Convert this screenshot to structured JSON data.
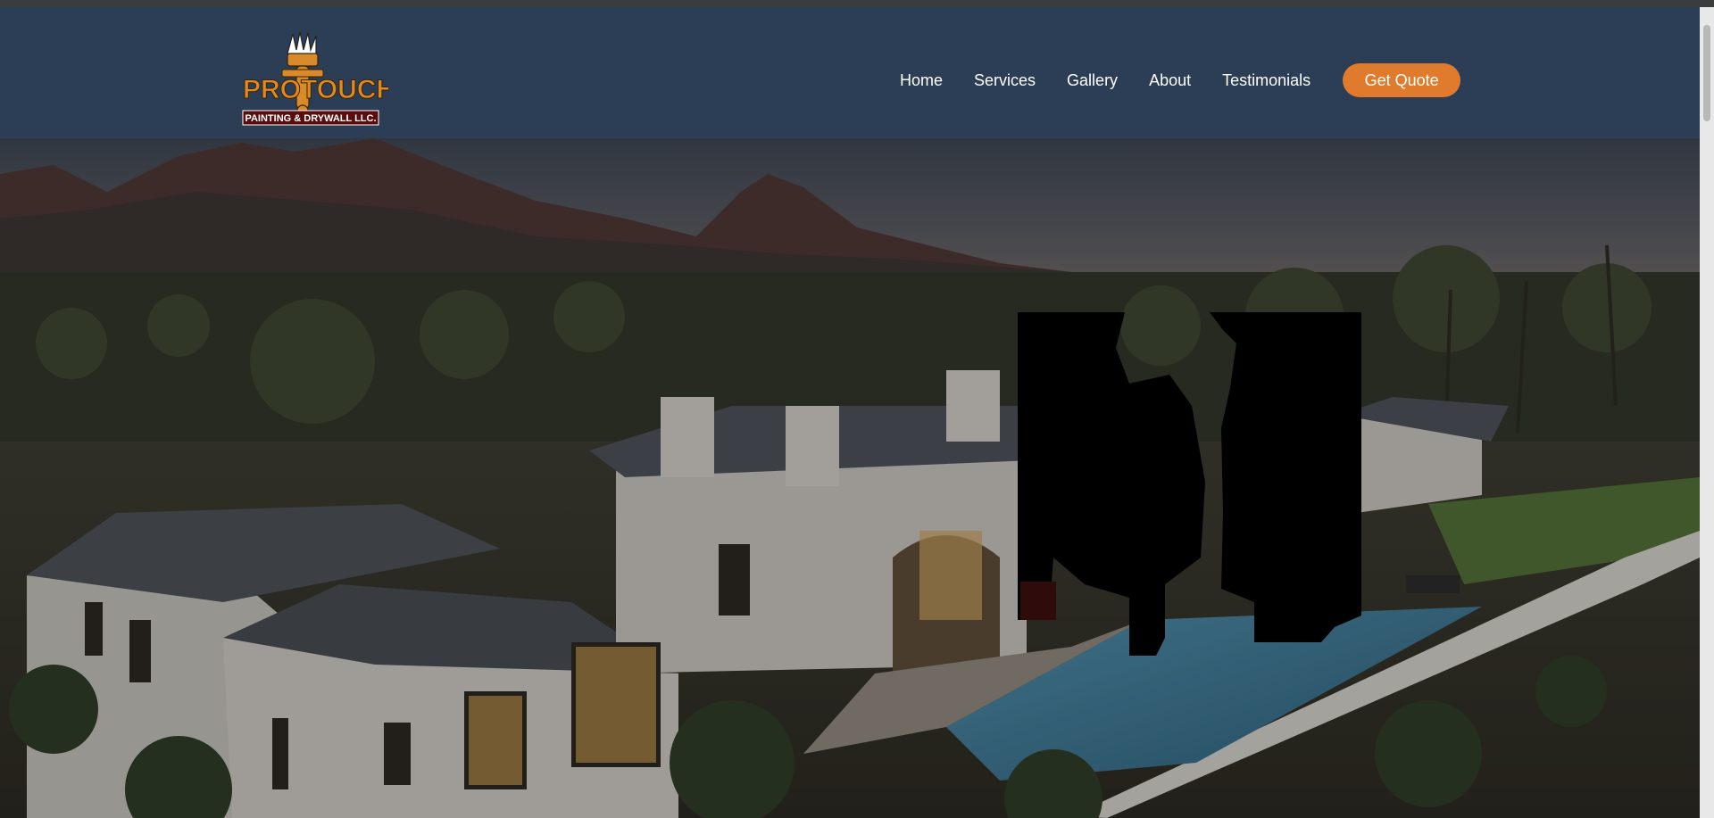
{
  "brand": {
    "logo_text_main": "PROTOUCH",
    "logo_text_sub": "PAINTING & DRYWALL LLC.",
    "icon": "paint-brush-icon"
  },
  "nav": {
    "items": [
      {
        "label": "Home"
      },
      {
        "label": "Services"
      },
      {
        "label": "Gallery"
      },
      {
        "label": "About"
      },
      {
        "label": "Testimonials"
      }
    ],
    "cta_label": "Get Quote"
  },
  "colors": {
    "navbar": "#2c3e55",
    "accent": "#e07a2c",
    "text": "#ffffff"
  }
}
